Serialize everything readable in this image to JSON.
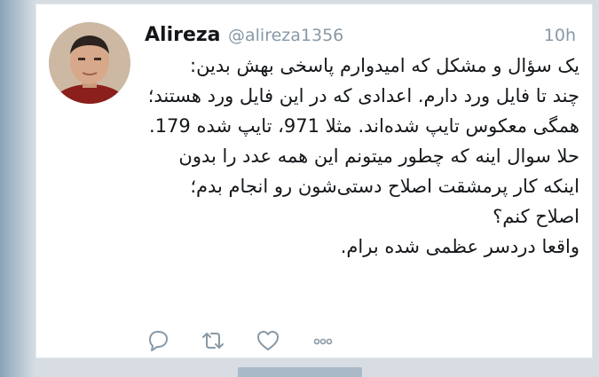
{
  "tweet": {
    "display_name": "Alireza",
    "username": "@alireza1356",
    "timestamp": "10h",
    "paragraphs": [
      "یک سؤال و مشکل که امیدوارم پاسخی بهش بدین:",
      "چند تا فایل ورد دارم. اعدادی که در این فایل ورد هستند؛ همگی معکوس تایپ شده‌اند. مثلا 971، تایپ شده 179.",
      "حلا سوال اینه که چطور میتونم این همه عدد را بدون اینکه کار پرمشقت اصلاح دستی‌شون رو انجام بدم؛ اصلاح کنم؟",
      "واقعا دردسر عظمی شده برام."
    ]
  },
  "actions": {
    "reply_icon": "reply-icon",
    "retweet_icon": "retweet-icon",
    "like_icon": "heart-icon",
    "more_icon": "more-icon",
    "icon_color": "#8899a6"
  },
  "colors": {
    "text": "#14171a",
    "muted": "#8899a6",
    "card_bg": "#ffffff"
  }
}
